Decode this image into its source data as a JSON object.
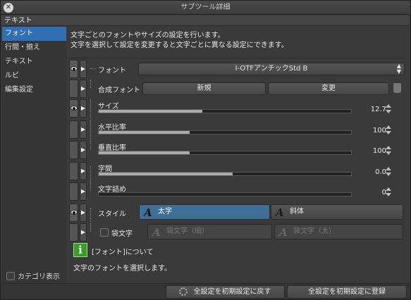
{
  "window": {
    "title": "サブツール詳細"
  },
  "section": {
    "header": "テキスト"
  },
  "sidebar": {
    "items": [
      {
        "label": "フォント",
        "active": true
      },
      {
        "label": "行間・揃え",
        "active": false
      },
      {
        "label": "テキスト",
        "active": false
      },
      {
        "label": "ルビ",
        "active": false
      },
      {
        "label": "編集設定",
        "active": false
      }
    ],
    "category_toggle_label": "カテゴリ表示"
  },
  "main": {
    "description_line1": "文字ごとのフォントやサイズの設定を行います。",
    "description_line2": "文字を選択して設定を変更すると文字ごとに異なる設定にできます。"
  },
  "font": {
    "label": "フォント",
    "value": "I-OTFアンチックStd B"
  },
  "composite_font": {
    "label": "合成フォント",
    "new_button": "新規",
    "edit_button": "変更"
  },
  "size": {
    "label": "サイズ",
    "value": "12.7",
    "fill_fraction": 0.41
  },
  "h_ratio": {
    "label": "水平比率",
    "value": "100",
    "fill_fraction": 0.36
  },
  "v_ratio": {
    "label": "垂直比率",
    "value": "100",
    "fill_fraction": 0.36
  },
  "char_spacing": {
    "label": "字間",
    "value": "0.0",
    "fill_fraction": 0.53
  },
  "kerning": {
    "label": "文字詰め",
    "value": "0",
    "fill_fraction": 0.0
  },
  "style": {
    "label": "スタイル",
    "bold_label": "太字",
    "italic_label": "斜体"
  },
  "outline": {
    "label": "袋文字",
    "thin_label": "袋文字（細）",
    "thick_label": "袋文字（太）"
  },
  "info": {
    "title": "[フォント]について",
    "body": "文字のフォントを選択します。"
  },
  "footer": {
    "reset_button": "全設定を初期設定に戻す",
    "register_button": "全設定を初期設定に登録"
  },
  "colors": {
    "accent": "#2f6fb5",
    "info_icon": "#3a9a2a",
    "bold_button": "#3f6f94"
  }
}
